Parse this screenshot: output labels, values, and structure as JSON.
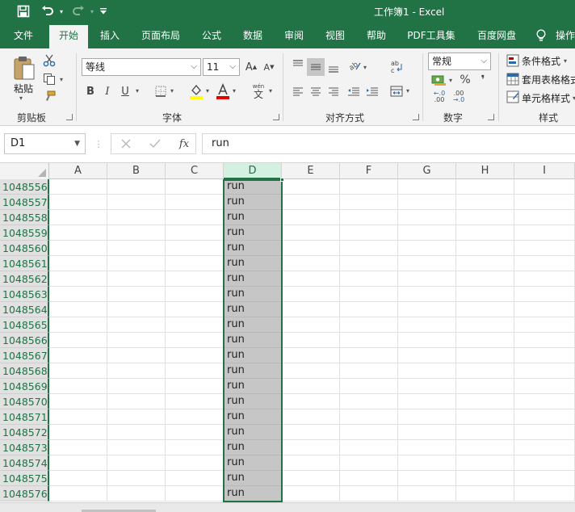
{
  "titlebar": {
    "title": "工作簿1  -  Excel",
    "qat": [
      {
        "name": "save-icon",
        "glyph": "🖫"
      },
      {
        "name": "undo-icon",
        "glyph": "↶"
      },
      {
        "name": "redo-icon",
        "glyph": "↷"
      },
      {
        "name": "customize-qat-icon",
        "glyph": "⏷"
      }
    ],
    "color": "#217346"
  },
  "tabs": [
    "文件",
    "开始",
    "插入",
    "页面布局",
    "公式",
    "数据",
    "审阅",
    "视图",
    "帮助",
    "PDF工具集",
    "百度网盘",
    "操作"
  ],
  "active_tab": "开始",
  "ribbon": {
    "clipboard": {
      "paste_label": "粘贴",
      "group_label": "剪贴板"
    },
    "font": {
      "font_name": "等线",
      "font_size": "11",
      "group_label": "字体",
      "bold": "B",
      "italic": "I",
      "underline": "U",
      "grow": "A",
      "shrink": "A",
      "phonetic_top": "wén",
      "phonetic_char": "文"
    },
    "alignment": {
      "group_label": "对齐方式"
    },
    "number": {
      "format": "常规",
      "group_label": "数字",
      "percent": "%",
      "comma": "❜",
      "inc_decimal": ".00",
      "dec_decimal": ".00"
    },
    "styles": {
      "group_label": "样式",
      "conditional": "条件格式",
      "table": "套用表格格式",
      "cell": "单元格样式"
    }
  },
  "formula_bar": {
    "name_box": "D1",
    "fx": "fx",
    "formula": "run"
  },
  "sheet": {
    "columns": [
      "A",
      "B",
      "C",
      "D",
      "E",
      "F",
      "G",
      "H",
      "I"
    ],
    "selected_column": "D",
    "rows": [
      {
        "num": "1048556",
        "d": "run"
      },
      {
        "num": "1048557",
        "d": "run"
      },
      {
        "num": "1048558",
        "d": "run"
      },
      {
        "num": "1048559",
        "d": "run"
      },
      {
        "num": "1048560",
        "d": "run"
      },
      {
        "num": "1048561",
        "d": "run"
      },
      {
        "num": "1048562",
        "d": "run"
      },
      {
        "num": "1048563",
        "d": "run"
      },
      {
        "num": "1048564",
        "d": "run"
      },
      {
        "num": "1048565",
        "d": "run"
      },
      {
        "num": "1048566",
        "d": "run"
      },
      {
        "num": "1048567",
        "d": "run"
      },
      {
        "num": "1048568",
        "d": "run"
      },
      {
        "num": "1048569",
        "d": "run"
      },
      {
        "num": "1048570",
        "d": "run"
      },
      {
        "num": "1048571",
        "d": "run"
      },
      {
        "num": "1048572",
        "d": "run"
      },
      {
        "num": "1048573",
        "d": "run"
      },
      {
        "num": "1048574",
        "d": "run"
      },
      {
        "num": "1048575",
        "d": "run"
      },
      {
        "num": "1048576",
        "d": "run"
      }
    ],
    "selection_color": "#c6c6c6",
    "accent": "#217346"
  }
}
